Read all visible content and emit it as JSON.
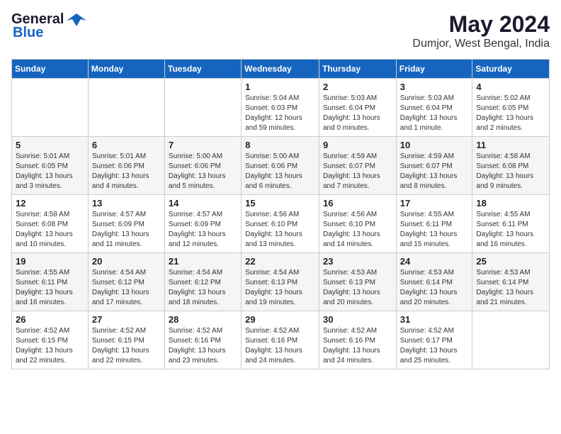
{
  "logo": {
    "line1": "General",
    "line2": "Blue"
  },
  "title": "May 2024",
  "subtitle": "Dumjor, West Bengal, India",
  "days_of_week": [
    "Sunday",
    "Monday",
    "Tuesday",
    "Wednesday",
    "Thursday",
    "Friday",
    "Saturday"
  ],
  "weeks": [
    [
      {
        "day": "",
        "info": ""
      },
      {
        "day": "",
        "info": ""
      },
      {
        "day": "",
        "info": ""
      },
      {
        "day": "1",
        "info": "Sunrise: 5:04 AM\nSunset: 6:03 PM\nDaylight: 12 hours\nand 59 minutes."
      },
      {
        "day": "2",
        "info": "Sunrise: 5:03 AM\nSunset: 6:04 PM\nDaylight: 13 hours\nand 0 minutes."
      },
      {
        "day": "3",
        "info": "Sunrise: 5:03 AM\nSunset: 6:04 PM\nDaylight: 13 hours\nand 1 minute."
      },
      {
        "day": "4",
        "info": "Sunrise: 5:02 AM\nSunset: 6:05 PM\nDaylight: 13 hours\nand 2 minutes."
      }
    ],
    [
      {
        "day": "5",
        "info": "Sunrise: 5:01 AM\nSunset: 6:05 PM\nDaylight: 13 hours\nand 3 minutes."
      },
      {
        "day": "6",
        "info": "Sunrise: 5:01 AM\nSunset: 6:06 PM\nDaylight: 13 hours\nand 4 minutes."
      },
      {
        "day": "7",
        "info": "Sunrise: 5:00 AM\nSunset: 6:06 PM\nDaylight: 13 hours\nand 5 minutes."
      },
      {
        "day": "8",
        "info": "Sunrise: 5:00 AM\nSunset: 6:06 PM\nDaylight: 13 hours\nand 6 minutes."
      },
      {
        "day": "9",
        "info": "Sunrise: 4:59 AM\nSunset: 6:07 PM\nDaylight: 13 hours\nand 7 minutes."
      },
      {
        "day": "10",
        "info": "Sunrise: 4:59 AM\nSunset: 6:07 PM\nDaylight: 13 hours\nand 8 minutes."
      },
      {
        "day": "11",
        "info": "Sunrise: 4:58 AM\nSunset: 6:08 PM\nDaylight: 13 hours\nand 9 minutes."
      }
    ],
    [
      {
        "day": "12",
        "info": "Sunrise: 4:58 AM\nSunset: 6:08 PM\nDaylight: 13 hours\nand 10 minutes."
      },
      {
        "day": "13",
        "info": "Sunrise: 4:57 AM\nSunset: 6:09 PM\nDaylight: 13 hours\nand 11 minutes."
      },
      {
        "day": "14",
        "info": "Sunrise: 4:57 AM\nSunset: 6:09 PM\nDaylight: 13 hours\nand 12 minutes."
      },
      {
        "day": "15",
        "info": "Sunrise: 4:56 AM\nSunset: 6:10 PM\nDaylight: 13 hours\nand 13 minutes."
      },
      {
        "day": "16",
        "info": "Sunrise: 4:56 AM\nSunset: 6:10 PM\nDaylight: 13 hours\nand 14 minutes."
      },
      {
        "day": "17",
        "info": "Sunrise: 4:55 AM\nSunset: 6:11 PM\nDaylight: 13 hours\nand 15 minutes."
      },
      {
        "day": "18",
        "info": "Sunrise: 4:55 AM\nSunset: 6:11 PM\nDaylight: 13 hours\nand 16 minutes."
      }
    ],
    [
      {
        "day": "19",
        "info": "Sunrise: 4:55 AM\nSunset: 6:11 PM\nDaylight: 13 hours\nand 16 minutes."
      },
      {
        "day": "20",
        "info": "Sunrise: 4:54 AM\nSunset: 6:12 PM\nDaylight: 13 hours\nand 17 minutes."
      },
      {
        "day": "21",
        "info": "Sunrise: 4:54 AM\nSunset: 6:12 PM\nDaylight: 13 hours\nand 18 minutes."
      },
      {
        "day": "22",
        "info": "Sunrise: 4:54 AM\nSunset: 6:13 PM\nDaylight: 13 hours\nand 19 minutes."
      },
      {
        "day": "23",
        "info": "Sunrise: 4:53 AM\nSunset: 6:13 PM\nDaylight: 13 hours\nand 20 minutes."
      },
      {
        "day": "24",
        "info": "Sunrise: 4:53 AM\nSunset: 6:14 PM\nDaylight: 13 hours\nand 20 minutes."
      },
      {
        "day": "25",
        "info": "Sunrise: 4:53 AM\nSunset: 6:14 PM\nDaylight: 13 hours\nand 21 minutes."
      }
    ],
    [
      {
        "day": "26",
        "info": "Sunrise: 4:52 AM\nSunset: 6:15 PM\nDaylight: 13 hours\nand 22 minutes."
      },
      {
        "day": "27",
        "info": "Sunrise: 4:52 AM\nSunset: 6:15 PM\nDaylight: 13 hours\nand 22 minutes."
      },
      {
        "day": "28",
        "info": "Sunrise: 4:52 AM\nSunset: 6:16 PM\nDaylight: 13 hours\nand 23 minutes."
      },
      {
        "day": "29",
        "info": "Sunrise: 4:52 AM\nSunset: 6:16 PM\nDaylight: 13 hours\nand 24 minutes."
      },
      {
        "day": "30",
        "info": "Sunrise: 4:52 AM\nSunset: 6:16 PM\nDaylight: 13 hours\nand 24 minutes."
      },
      {
        "day": "31",
        "info": "Sunrise: 4:52 AM\nSunset: 6:17 PM\nDaylight: 13 hours\nand 25 minutes."
      },
      {
        "day": "",
        "info": ""
      }
    ]
  ]
}
